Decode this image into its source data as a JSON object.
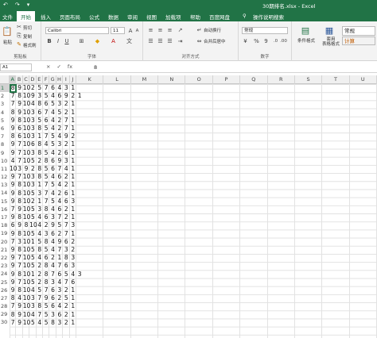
{
  "window": {
    "title": "30期排名.xlsx  -  Excel",
    "accent": "#217346",
    "qat": [
      "↶",
      "↷",
      "▾"
    ]
  },
  "tabs": [
    "文件",
    "开始",
    "插入",
    "页面布局",
    "公式",
    "数据",
    "审阅",
    "视图",
    "加载项",
    "帮助",
    "百度网盘",
    "操作说明搜索"
  ],
  "ribbon": {
    "clipboard": {
      "paste": "粘贴",
      "cut": "剪切",
      "copy": "复制",
      "format_painter": "格式刷",
      "label": "剪贴板"
    },
    "font": {
      "name": "Calibri",
      "size": "11",
      "bold": "B",
      "italic": "I",
      "underline": "U",
      "label": "字体"
    },
    "alignment": {
      "wrap": "自动换行",
      "merge": "合并后居中",
      "label": "对齐方式"
    },
    "number": {
      "format": "常规",
      "percent": "%",
      "comma": "9",
      "label": "数字"
    },
    "styles": {
      "conditional": "条件格式",
      "table": "套用\n表格格式",
      "style_normal": "常规",
      "style_calc": "计算"
    }
  },
  "formula_bar": {
    "name_box": "A1",
    "cancel": "×",
    "enter": "✓",
    "fx": "fx",
    "content": "8"
  },
  "columns": [
    "A",
    "B",
    "C",
    "D",
    "E",
    "F",
    "G",
    "H",
    "I",
    "J",
    "K",
    "L",
    "M",
    "N",
    "O",
    "P",
    "Q",
    "R",
    "S",
    "T",
    "U"
  ],
  "rows": [
    [
      "8",
      "9",
      "10",
      "2",
      "5",
      "7",
      "6",
      "4",
      "3",
      "1"
    ],
    [
      "7",
      "8",
      "10",
      "9",
      "3",
      "5",
      "4",
      "6",
      "9",
      "2",
      "1"
    ],
    [
      "7",
      "9",
      "10",
      "4",
      "8",
      "6",
      "5",
      "3",
      "2",
      "1"
    ],
    [
      "8",
      "9",
      "10",
      "3",
      "6",
      "7",
      "4",
      "5",
      "2",
      "1"
    ],
    [
      "9",
      "8",
      "10",
      "3",
      "5",
      "6",
      "4",
      "2",
      "7",
      "1"
    ],
    [
      "9",
      "6",
      "10",
      "3",
      "8",
      "5",
      "4",
      "2",
      "7",
      "1"
    ],
    [
      "8",
      "6",
      "10",
      "3",
      "1",
      "7",
      "5",
      "4",
      "9",
      "2"
    ],
    [
      "9",
      "7",
      "10",
      "6",
      "8",
      "4",
      "5",
      "3",
      "2",
      "1"
    ],
    [
      "9",
      "7",
      "10",
      "3",
      "8",
      "5",
      "4",
      "2",
      "6",
      "1"
    ],
    [
      "4",
      "7",
      "10",
      "5",
      "2",
      "8",
      "6",
      "9",
      "3",
      "1"
    ],
    [
      "10",
      "3",
      "9",
      "2",
      "8",
      "5",
      "6",
      "7",
      "4",
      "1"
    ],
    [
      "9",
      "7",
      "10",
      "3",
      "8",
      "5",
      "4",
      "6",
      "2",
      "1"
    ],
    [
      "9",
      "8",
      "10",
      "3",
      "1",
      "7",
      "5",
      "4",
      "2",
      "1"
    ],
    [
      "9",
      "8",
      "10",
      "5",
      "3",
      "7",
      "4",
      "2",
      "6",
      "1"
    ],
    [
      "9",
      "8",
      "10",
      "2",
      "1",
      "7",
      "5",
      "4",
      "6",
      "3"
    ],
    [
      "7",
      "9",
      "10",
      "5",
      "3",
      "8",
      "4",
      "6",
      "2",
      "1"
    ],
    [
      "9",
      "8",
      "10",
      "5",
      "4",
      "6",
      "3",
      "7",
      "2",
      "1"
    ],
    [
      "6",
      "9",
      "8",
      "10",
      "4",
      "2",
      "9",
      "5",
      "7",
      "3"
    ],
    [
      "9",
      "8",
      "10",
      "5",
      "4",
      "3",
      "6",
      "2",
      "7",
      "1"
    ],
    [
      "7",
      "3",
      "10",
      "1",
      "5",
      "8",
      "4",
      "9",
      "6",
      "2"
    ],
    [
      "9",
      "8",
      "10",
      "5",
      "8",
      "5",
      "4",
      "7",
      "3",
      "2"
    ],
    [
      "9",
      "7",
      "10",
      "5",
      "4",
      "6",
      "2",
      "1",
      "8",
      "3"
    ],
    [
      "9",
      "7",
      "10",
      "5",
      "2",
      "8",
      "4",
      "7",
      "6",
      "3"
    ],
    [
      "9",
      "8",
      "10",
      "1",
      "2",
      "8",
      "7",
      "6",
      "5",
      "4",
      "3"
    ],
    [
      "9",
      "7",
      "10",
      "5",
      "2",
      "8",
      "3",
      "4",
      "7",
      "6"
    ],
    [
      "9",
      "8",
      "10",
      "4",
      "5",
      "7",
      "6",
      "3",
      "2",
      "1"
    ],
    [
      "8",
      "4",
      "10",
      "3",
      "7",
      "9",
      "6",
      "2",
      "5",
      "1"
    ],
    [
      "7",
      "9",
      "10",
      "3",
      "8",
      "5",
      "6",
      "4",
      "2",
      "1"
    ],
    [
      "8",
      "9",
      "10",
      "4",
      "7",
      "5",
      "3",
      "6",
      "2",
      "1"
    ],
    [
      "7",
      "9",
      "10",
      "5",
      "4",
      "5",
      "8",
      "3",
      "2",
      "1"
    ]
  ]
}
